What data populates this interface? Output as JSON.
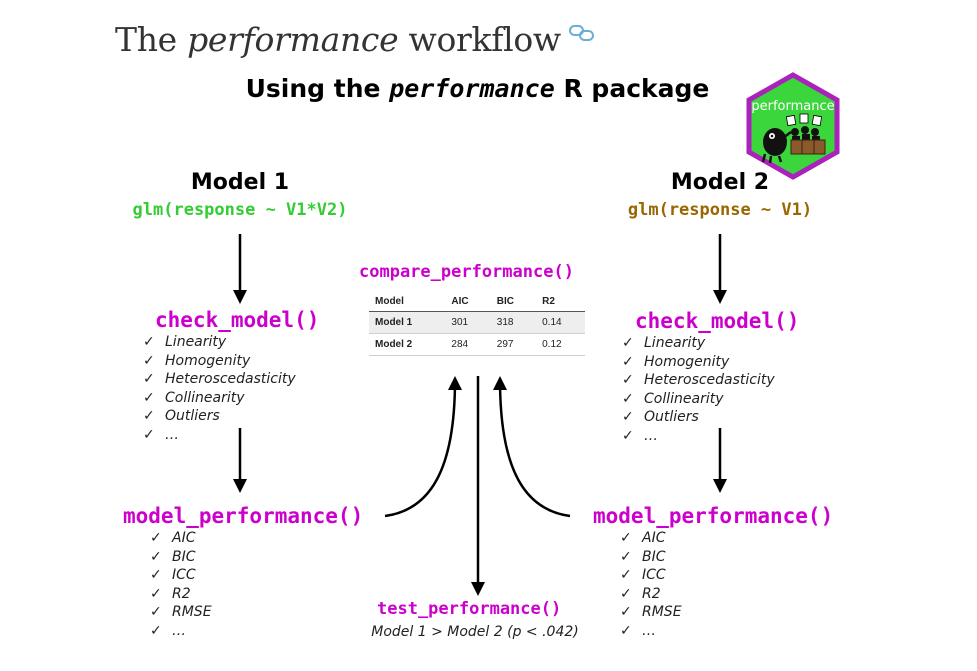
{
  "title": {
    "prefix": "The ",
    "italic": "performance",
    "suffix": " workflow"
  },
  "subtitle": {
    "prefix": "Using the ",
    "italic": "performance",
    "suffix": " R package"
  },
  "logo": {
    "text": "performance",
    "icon": "performance-hex-logo"
  },
  "colors": {
    "fn": "#cc00cc",
    "model1_formula": "#33cc33",
    "model2_formula": "#996600",
    "hex_fill": "#3bd63b",
    "hex_border": "#aa22bb"
  },
  "model1": {
    "title": "Model 1",
    "formula": "glm(response ~ V1*V2)",
    "check_fn": "check_model()",
    "checks": [
      "Linearity",
      "Homogenity",
      "Heteroscedasticity",
      "Collinearity",
      "Outliers",
      "…"
    ],
    "perf_fn": "model_performance()",
    "metrics": [
      "AIC",
      "BIC",
      "ICC",
      "R2",
      "RMSE",
      "…"
    ]
  },
  "model2": {
    "title": "Model 2",
    "formula": "glm(response ~ V1)",
    "check_fn": "check_model()",
    "checks": [
      "Linearity",
      "Homogenity",
      "Heteroscedasticity",
      "Collinearity",
      "Outliers",
      "…"
    ],
    "perf_fn": "model_performance()",
    "metrics": [
      "AIC",
      "BIC",
      "ICC",
      "R2",
      "RMSE",
      "…"
    ]
  },
  "compare": {
    "fn": "compare_performance()",
    "headers": [
      "Model",
      "AIC",
      "BIC",
      "R2"
    ],
    "rows": [
      [
        "Model 1",
        "301",
        "318",
        "0.14"
      ],
      [
        "Model 2",
        "284",
        "297",
        "0.12"
      ]
    ]
  },
  "test": {
    "fn": "test_performance()",
    "result": "Model 1 > Model 2 (p < .042)"
  },
  "check_mark": "✓"
}
